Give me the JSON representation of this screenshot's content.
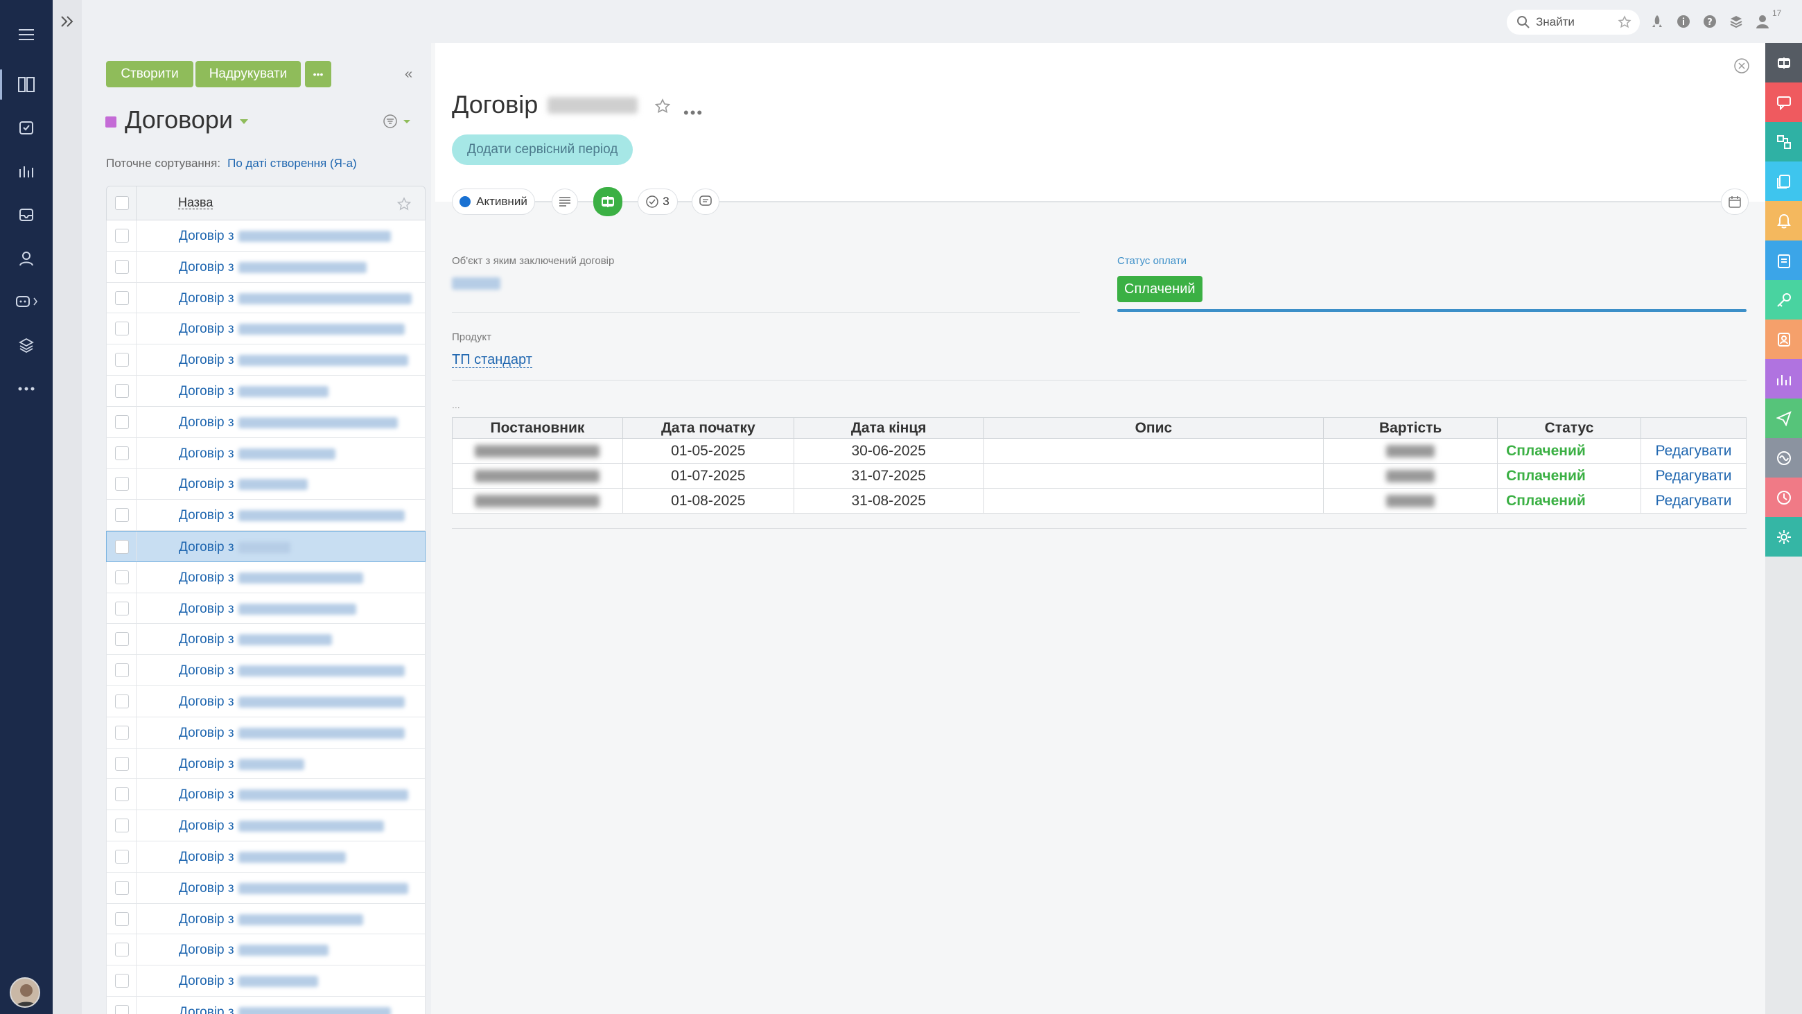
{
  "topbar": {
    "search_placeholder": "Знайти",
    "notifications_count": "17"
  },
  "toolbar": {
    "create_label": "Створити",
    "print_label": "Надрукувати",
    "more_label": "•••"
  },
  "list": {
    "entity_title": "Договори",
    "sort_label": "Поточне сортування:",
    "sort_value": "По даті створення (Я-а)",
    "column_name": "Назва",
    "row_prefix": "Договір з",
    "rows": [
      {
        "prefix": "Договір з",
        "selected": false
      },
      {
        "prefix": "Договір з",
        "selected": false
      },
      {
        "prefix": "Договір з",
        "selected": false
      },
      {
        "prefix": "Договір з",
        "selected": false
      },
      {
        "prefix": "Договір з",
        "selected": false
      },
      {
        "prefix": "Договір з",
        "selected": false
      },
      {
        "prefix": "Договір з",
        "selected": false
      },
      {
        "prefix": "Договір з",
        "selected": false
      },
      {
        "prefix": "Договір з",
        "selected": false
      },
      {
        "prefix": "Договір з",
        "selected": false
      },
      {
        "prefix": "Договір з",
        "selected": true
      },
      {
        "prefix": "Договір з",
        "selected": false
      },
      {
        "prefix": "Договір з",
        "selected": false
      },
      {
        "prefix": "Договір з",
        "selected": false
      },
      {
        "prefix": "Договір з",
        "selected": false
      },
      {
        "prefix": "Договір з",
        "selected": false
      },
      {
        "prefix": "Договір з",
        "selected": false
      },
      {
        "prefix": "Договір з",
        "selected": false
      },
      {
        "prefix": "Договір з",
        "selected": false
      },
      {
        "prefix": "Договір з",
        "selected": false
      },
      {
        "prefix": "Договір з",
        "selected": false
      },
      {
        "prefix": "Договір з",
        "selected": false
      },
      {
        "prefix": "Договір з",
        "selected": false
      },
      {
        "prefix": "Договір з",
        "selected": false
      },
      {
        "prefix": "Договір з",
        "selected": false
      },
      {
        "prefix": "Договір з",
        "selected": false
      }
    ]
  },
  "detail": {
    "title": "Договір",
    "add_period_label": "Додати сервісний період",
    "status_label": "Активний",
    "tasks_count": "3",
    "object_label": "Об'єкт з яким заключений договір",
    "payment_label": "Статус оплати",
    "payment_value": "Сплачений",
    "product_label": "Продукт",
    "product_value": "ТП стандарт",
    "section_ellipsis": "...",
    "table": {
      "headers": [
        "Постановник",
        "Дата початку",
        "Дата кінця",
        "Опис",
        "Вартість",
        "Статус",
        ""
      ],
      "rows": [
        {
          "start": "01-05-2025",
          "end": "30-06-2025",
          "status": "Сплачений",
          "action": "Редагувати"
        },
        {
          "start": "01-07-2025",
          "end": "31-07-2025",
          "status": "Сплачений",
          "action": "Редагувати"
        },
        {
          "start": "01-08-2025",
          "end": "31-08-2025",
          "status": "Сплачений",
          "action": "Редагувати"
        }
      ]
    }
  },
  "colors": {
    "rail": "#1b2a4a",
    "accent_green": "#8fbc5a",
    "status_green": "#3bb044",
    "link_blue": "#2067b0",
    "pill_teal": "#a6e7e6"
  },
  "right_bar_icons": [
    {
      "name": "crm-icon",
      "color": "#555b63"
    },
    {
      "name": "chat-icon",
      "color": "#ef5a5f"
    },
    {
      "name": "transfer-icon",
      "color": "#2fb1a4"
    },
    {
      "name": "documents-icon",
      "color": "#3ec5ee"
    },
    {
      "name": "bell-icon",
      "color": "#f4b85e"
    },
    {
      "name": "clipboard-icon",
      "color": "#3ba5e8"
    },
    {
      "name": "key-icon",
      "color": "#49d3a0"
    },
    {
      "name": "contact-icon",
      "color": "#f5a06b"
    },
    {
      "name": "analytics-icon",
      "color": "#b073e0"
    },
    {
      "name": "send-icon",
      "color": "#56c47a"
    },
    {
      "name": "pulse-icon",
      "color": "#8b93a0"
    },
    {
      "name": "clock-icon",
      "color": "#f07a86"
    },
    {
      "name": "settings-icon",
      "color": "#35b6a5"
    }
  ]
}
